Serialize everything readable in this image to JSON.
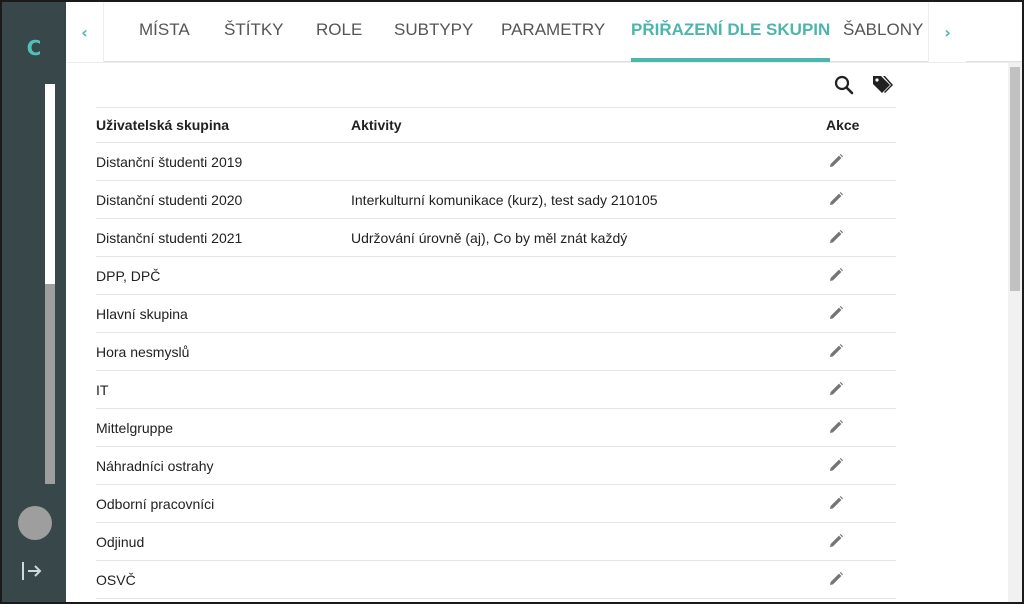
{
  "rail": {
    "logo": "C",
    "progress": 0.5
  },
  "tabs": {
    "items": [
      {
        "label": "Místa"
      },
      {
        "label": "Štítky"
      },
      {
        "label": "Role"
      },
      {
        "label": "Subtypy"
      },
      {
        "label": "Parametry"
      },
      {
        "label": "Přiřazení dle skupin",
        "active": true
      },
      {
        "label": "Šablony em"
      }
    ],
    "prev_icon": "chevron-left-icon",
    "next_icon": "chevron-right-icon"
  },
  "toolbar": {
    "search_icon": "search-icon",
    "tags_icon": "tags-icon"
  },
  "table": {
    "headers": {
      "group": "Uživatelská skupina",
      "activities": "Aktivity",
      "actions": "Akce"
    },
    "rows": [
      {
        "group": "Distanční študenti 2019",
        "activities": ""
      },
      {
        "group": "Distanční studenti 2020",
        "activities": "Interkulturní komunikace (kurz),  test sady 210105"
      },
      {
        "group": "Distanční studenti 2021",
        "activities": "Udržování úrovně (aj),  Co by měl znát každý"
      },
      {
        "group": "DPP, DPČ",
        "activities": ""
      },
      {
        "group": "Hlavní skupina",
        "activities": ""
      },
      {
        "group": "Hora nesmyslů",
        "activities": ""
      },
      {
        "group": "IT",
        "activities": ""
      },
      {
        "group": "Mittelgruppe",
        "activities": ""
      },
      {
        "group": "Náhradníci ostrahy",
        "activities": ""
      },
      {
        "group": "Odborní pracovníci",
        "activities": ""
      },
      {
        "group": "Odjinud",
        "activities": ""
      },
      {
        "group": "OSVČ",
        "activities": ""
      }
    ]
  },
  "colors": {
    "accent": "#4db6ac",
    "rail": "#37474a"
  }
}
